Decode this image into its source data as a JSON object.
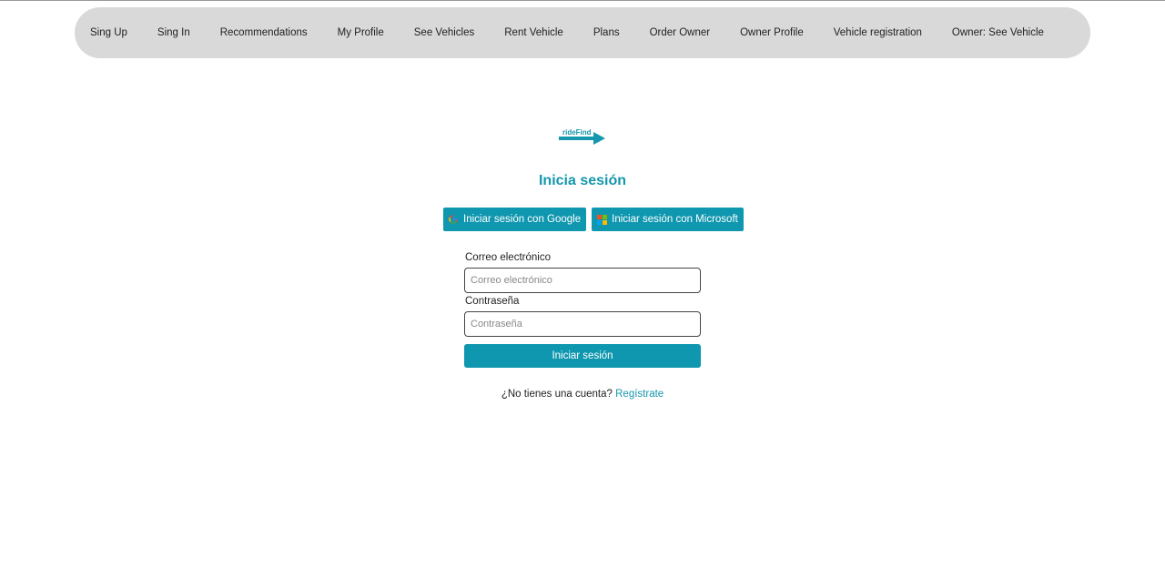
{
  "nav": {
    "items": [
      "Sing Up",
      "Sing In",
      "Recommendations",
      "My Profile",
      "See Vehicles",
      "Rent Vehicle",
      "Plans",
      "Order Owner",
      "Owner Profile",
      "Vehicle registration",
      "Owner: See Vehicle"
    ]
  },
  "logo": {
    "text": "rideFind"
  },
  "login": {
    "title": "Inicia sesión",
    "google_label": "Iniciar sesión con Google",
    "microsoft_label": "Iniciar sesión con Microsoft",
    "email_label": "Correo electrónico",
    "email_placeholder": "Correo electrónico",
    "email_value": "",
    "password_label": "Contraseña",
    "password_placeholder": "Contraseña",
    "password_value": "",
    "submit_label": "Iniciar sesión",
    "signup_prompt": "¿No tienes una cuenta?",
    "signup_link": "Regístrate"
  },
  "colors": {
    "accent": "#0f97af",
    "title": "#1597ad",
    "navbar_bg": "#d9d9d9"
  },
  "icons": {
    "google": "google-icon",
    "microsoft": "microsoft-icon",
    "logo_arrow": "arrow-right-icon"
  }
}
